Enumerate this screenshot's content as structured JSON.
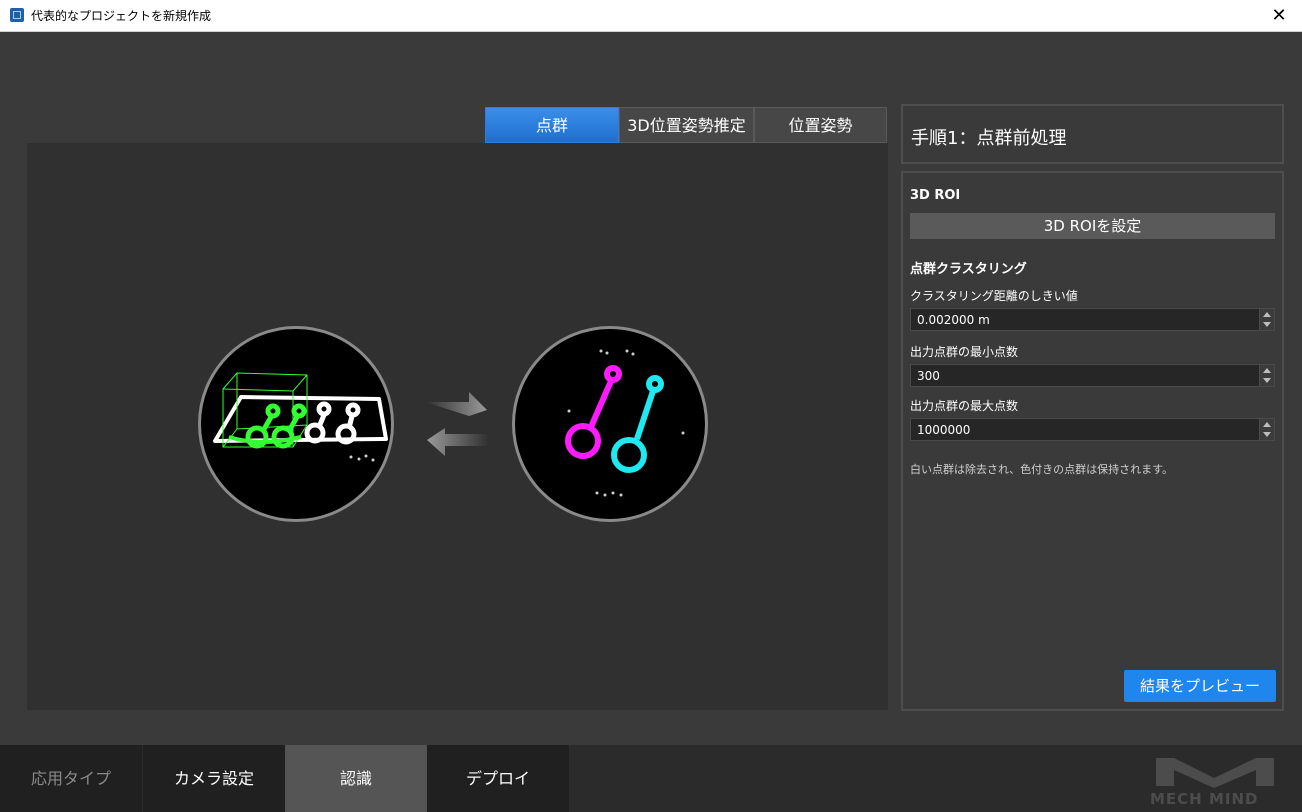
{
  "window": {
    "title": "代表的なプロジェクトを新規作成",
    "close_glyph": "✕"
  },
  "tabs": [
    {
      "label": "点群",
      "active": true
    },
    {
      "label": "3D位置姿勢推定",
      "active": false
    },
    {
      "label": "位置姿勢",
      "active": false
    }
  ],
  "colors": {
    "accent": "#1f86ee",
    "tab_active": "#2a7ee0",
    "cluster_magenta": "#ff1aff",
    "cluster_cyan": "#1ee8f0",
    "roi_green": "#33ff33"
  },
  "step": {
    "title": "手順1：点群前処理"
  },
  "roi": {
    "section_title": "3D ROI",
    "button_label": "3D ROIを設定"
  },
  "clustering": {
    "section_title": "点群クラスタリング",
    "fields": [
      {
        "label": "クラスタリング距離のしきい値",
        "value": "0.002000 m"
      },
      {
        "label": "出力点群の最小点数",
        "value": "300"
      },
      {
        "label": "出力点群の最大点数",
        "value": "1000000"
      }
    ],
    "hint": "白い点群は除去され、色付きの点群は保持されます。"
  },
  "preview_button": "結果をプレビュー",
  "bottom_nav": [
    {
      "label": "応用タイプ",
      "state": "disabled"
    },
    {
      "label": "カメラ設定",
      "state": "normal"
    },
    {
      "label": "認識",
      "state": "active"
    },
    {
      "label": "デプロイ",
      "state": "normal"
    }
  ],
  "logo_text": "MECH MIND"
}
